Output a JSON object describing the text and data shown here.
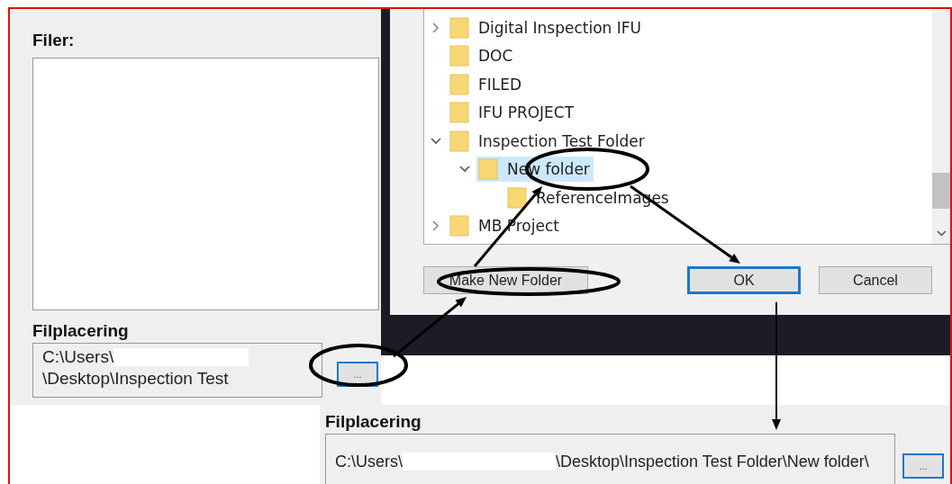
{
  "left_panel": {
    "files_label": "Filer:",
    "location_label": "Filplacering",
    "location_lines": [
      "C:\\Users\\",
      "\\Desktop\\Inspection Test"
    ],
    "browse_button": "..."
  },
  "dialog": {
    "tree": [
      {
        "label": "Digital Inspection IFU",
        "expanded": false,
        "selected": false
      },
      {
        "label": "DOC",
        "selected": false
      },
      {
        "label": "FILED",
        "selected": false
      },
      {
        "label": "IFU PROJECT",
        "selected": false
      },
      {
        "label": "Inspection Test Folder",
        "expanded": true,
        "selected": false,
        "children": [
          {
            "label": "New folder",
            "expanded": true,
            "selected": true,
            "children": [
              {
                "label": "ReferenceImages",
                "selected": false
              }
            ]
          }
        ]
      },
      {
        "label": "MB Project",
        "expanded": false,
        "selected": false
      }
    ],
    "buttons": [
      {
        "label": "Make New Folder",
        "kind": "left",
        "focused": false
      },
      {
        "label": "OK",
        "kind": "right",
        "focused": true
      },
      {
        "label": "Cancel",
        "kind": "right",
        "focused": false
      }
    ]
  },
  "result_panel": {
    "location_label": "Filplacering",
    "location_parts": [
      "C:\\Users\\",
      "\\Desktop\\Inspection Test Folder\\New folder\\"
    ],
    "browse_button": "..."
  }
}
